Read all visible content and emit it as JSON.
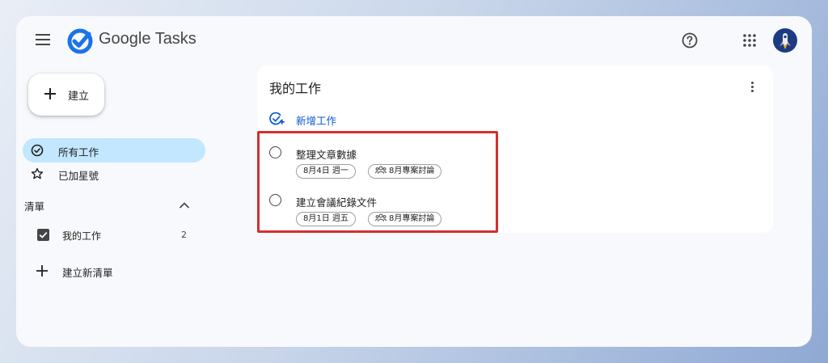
{
  "header": {
    "app_title": "Google Tasks",
    "icons": [
      "menu-icon",
      "tasks-logo-icon",
      "help-icon",
      "apps-grid-icon",
      "avatar"
    ]
  },
  "sidebar": {
    "create_label": "建立",
    "nav": [
      {
        "label": "所有工作",
        "icon": "check-circle-icon",
        "active": true
      },
      {
        "label": "已加星號",
        "icon": "star-icon",
        "active": false
      }
    ],
    "lists_section_label": "清單",
    "lists": [
      {
        "label": "我的工作",
        "count": "2",
        "checked": true
      }
    ],
    "new_list_label": "建立新清單"
  },
  "main": {
    "list_title": "我的工作",
    "add_task_label": "新增工作",
    "tasks": [
      {
        "title": "整理文章數據",
        "date": "8月4日 週一",
        "list_chip": "8月專案討論"
      },
      {
        "title": "建立會議紀錄文件",
        "date": "8月1日 週五",
        "list_chip": "8月專案討論"
      }
    ]
  },
  "colors": {
    "accent_blue": "#0b57d0",
    "active_nav": "#c2e7ff",
    "highlight_red": "#d62e2e",
    "logo_blue": "#1a73e8"
  }
}
